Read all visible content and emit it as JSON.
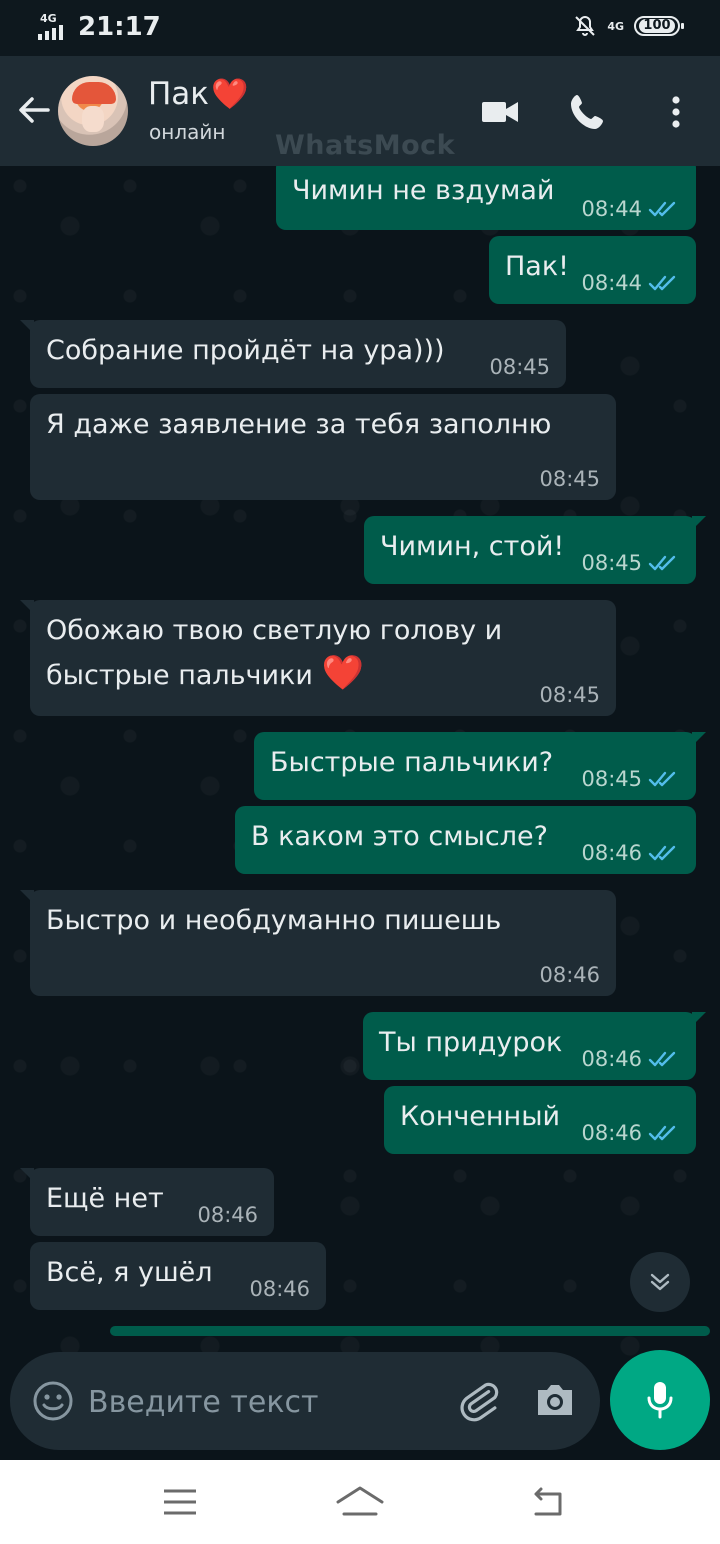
{
  "status_bar": {
    "network": "4G",
    "time": "21:17",
    "network_right": "4G",
    "battery": "100"
  },
  "header": {
    "contact_name": "Пак",
    "contact_emoji": "❤️",
    "status": "онлайн",
    "watermark": "WhatsMock",
    "icons": [
      "back-arrow-icon",
      "video-call-icon",
      "phone-icon",
      "more-vert-icon"
    ]
  },
  "messages": [
    {
      "dir": "out",
      "text": "Чимин не вздумай",
      "time": "08:44",
      "read": true
    },
    {
      "dir": "out",
      "text": "Пак!",
      "time": "08:44",
      "read": true
    },
    {
      "dir": "in",
      "text": "Собрание пройдёт на ура)))",
      "time": "08:45"
    },
    {
      "dir": "in",
      "text": "Я даже заявление за тебя заполню",
      "time": "08:45"
    },
    {
      "dir": "out",
      "text": "Чимин, стой!",
      "time": "08:45",
      "read": true
    },
    {
      "dir": "in",
      "text_line1": "Обожаю твою светлую голову и",
      "text_line2": "быстрые пальчики",
      "emoji": "❤️",
      "time": "08:45"
    },
    {
      "dir": "out",
      "text": "Быстрые пальчики?",
      "time": "08:45",
      "read": true
    },
    {
      "dir": "out",
      "text": "В каком это смысле?",
      "time": "08:46",
      "read": true
    },
    {
      "dir": "in",
      "text": "Быстро и необдуманно пишешь",
      "time": "08:46"
    },
    {
      "dir": "out",
      "text": "Ты придурок",
      "time": "08:46",
      "read": true
    },
    {
      "dir": "out",
      "text": "Конченный",
      "time": "08:46",
      "read": true
    },
    {
      "dir": "in",
      "text": "Ещё нет",
      "time": "08:46"
    },
    {
      "dir": "in",
      "text": "Всё, я ушёл",
      "time": "08:46"
    }
  ],
  "input": {
    "placeholder": "Введите текст"
  },
  "colors": {
    "bg": "#0b141a",
    "header": "#1f2c34",
    "incoming": "#1f2c34",
    "outgoing": "#005c4b",
    "accent": "#00a884",
    "read_tick": "#53bdeb"
  }
}
